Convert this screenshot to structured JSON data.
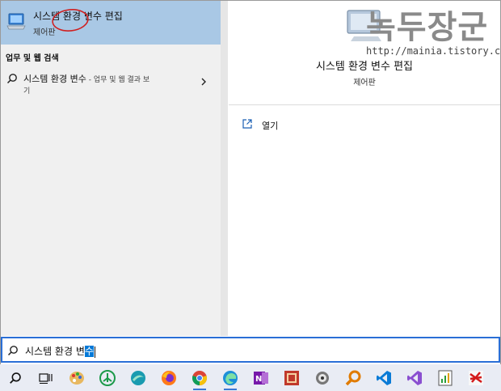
{
  "best_match": {
    "title": "시스템 환경 변수 편집",
    "subtitle": "제어판"
  },
  "left": {
    "section_heading": "업무 및 웹 검색",
    "web_item": {
      "main": "시스템 환경 변수",
      "rest": " - 업무 및 웹 결과 보",
      "line2": "기"
    }
  },
  "watermark": {
    "text": "녹두장군",
    "url": "http://mainia.tistory.com"
  },
  "detail": {
    "title": "시스템 환경 변수 편집",
    "subtitle": "제어판",
    "open_label": "열기"
  },
  "search": {
    "query_prefix": "시스템 환경 변",
    "query_selected": "수"
  },
  "taskbar": {
    "items": [
      "search-icon",
      "task-view-icon",
      "paint-palette-icon",
      "tree-app-icon",
      "browser-swirl-icon",
      "firefox-icon",
      "chrome-icon",
      "edge-icon",
      "onenote-icon",
      "filmstrip-icon",
      "settings-wheel-icon",
      "magnifier-app-icon",
      "vscode-icon",
      "visual-studio-icon",
      "notepad-chart-icon",
      "red-app-icon"
    ]
  },
  "colors": {
    "selection": "#a9c8e5",
    "accent": "#2a6fd6",
    "text_selection": "#0078d7",
    "left_bg": "#f0f0f0",
    "taskbar_bg": "#e9ecf4"
  }
}
